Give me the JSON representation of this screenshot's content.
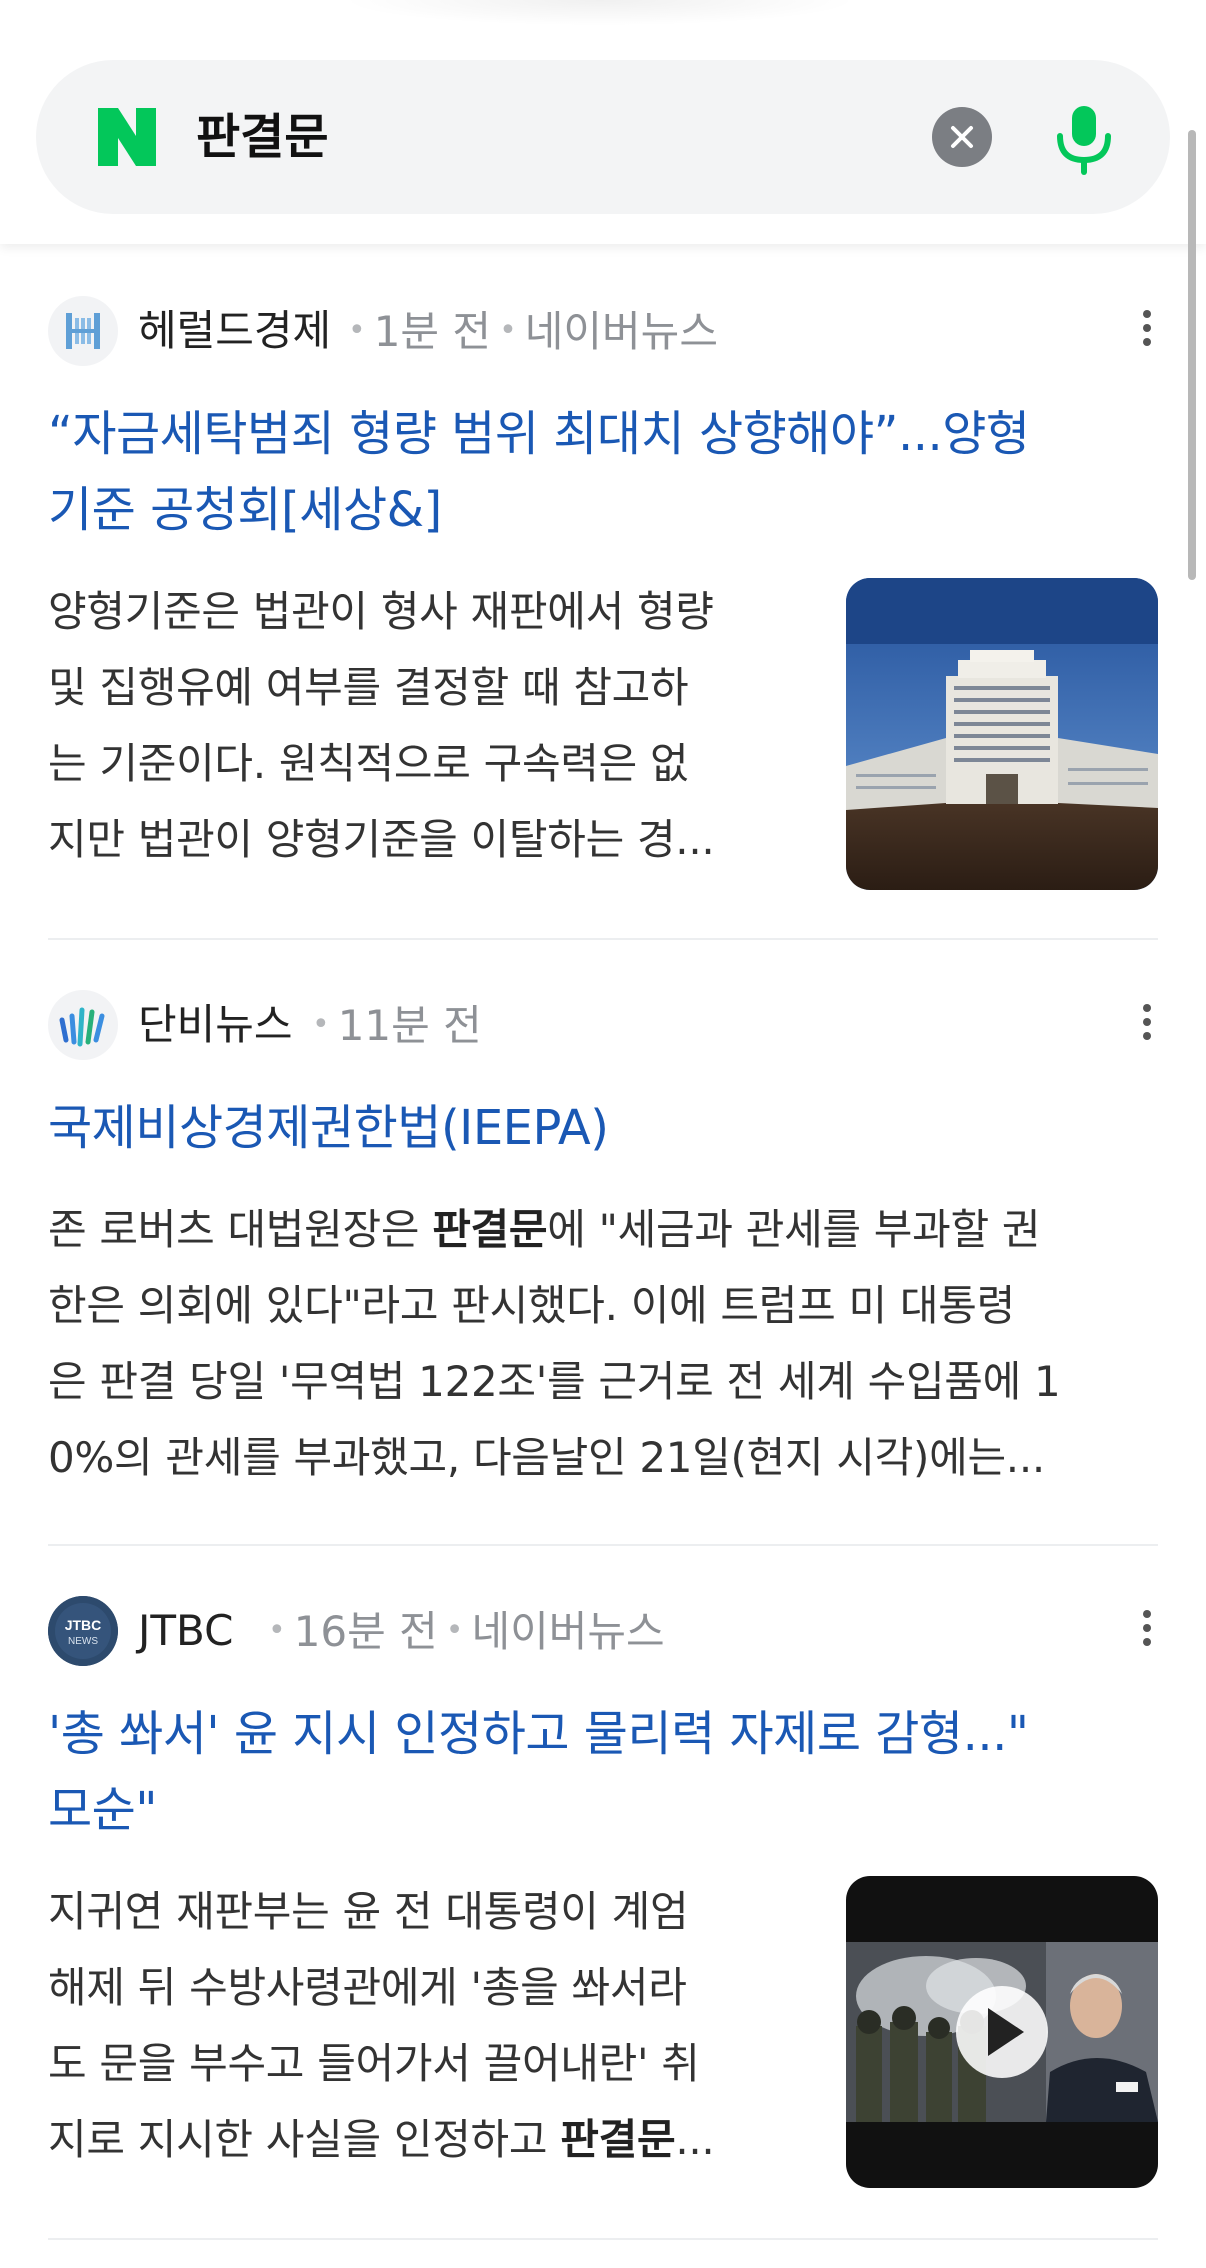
{
  "search": {
    "query": "판결문"
  },
  "colors": {
    "naver_green": "#03C75A",
    "headline_blue": "#1A58B4",
    "meta_gray": "#8E9196"
  },
  "results": [
    {
      "press": "헤럴드경제",
      "press_icon": "herald-logo-icon",
      "time": "1분 전",
      "source": "네이버뉴스",
      "headline_lines": [
        "“자금세탁범죄 형량 범위 최대치 상향해야”...양형",
        "기준 공청회[세상&]"
      ],
      "summary_lines": [
        "양형기준은 법관이 형사 재판에서 형량",
        "및 집행유예 여부를 결정할 때 참고하",
        "는 기준이다. 원칙적으로 구속력은 없",
        "지만 법관이 양형기준을 이탈하는 경..."
      ],
      "thumbnail": "supreme-court-building-image"
    },
    {
      "press": "단비뉴스",
      "press_icon": "danbi-logo-icon",
      "time": "11분 전",
      "headline_lines": [
        "국제비상경제권한법(IEEPA)"
      ],
      "summary_lines": [
        {
          "pre": "존 로버츠 대법원장은 ",
          "bold": "판결문",
          "post": "에 \"세금과 관세를 부과할 권"
        },
        {
          "pre": "한은 의회에 있다\"라고 판시했다. 이에 트럼프 미 대통령",
          "bold": "",
          "post": ""
        },
        {
          "pre": "은 판결 당일 '무역법 122조'를 근거로 전 세계 수입품에 1",
          "bold": "",
          "post": ""
        },
        {
          "pre": "0%의 관세를 부과했고, 다음날인 21일(현지 시각)에는...",
          "bold": "",
          "post": ""
        }
      ]
    },
    {
      "press": "JTBC",
      "press_icon": "jtbc-news-logo-icon",
      "time": "16분 전",
      "source": "네이버뉴스",
      "headline_lines": [
        "'총 쏴서' 윤 지시 인정하고 물리력 자제로 감형...\"",
        "모순\""
      ],
      "summary_lines": [
        {
          "pre": "지귀연 재판부는 윤 전 대통령이 계엄",
          "bold": "",
          "post": ""
        },
        {
          "pre": "해제 뒤 수방사령관에게 '총을 쏴서라",
          "bold": "",
          "post": ""
        },
        {
          "pre": "도 문을 부수고 들어가서 끌어내란' 취",
          "bold": "",
          "post": ""
        },
        {
          "pre": "지로 지시한 사실을 인정하고 ",
          "bold": "판결문",
          "post": "..."
        }
      ],
      "thumbnail": "video-thumbnail-image"
    }
  ]
}
